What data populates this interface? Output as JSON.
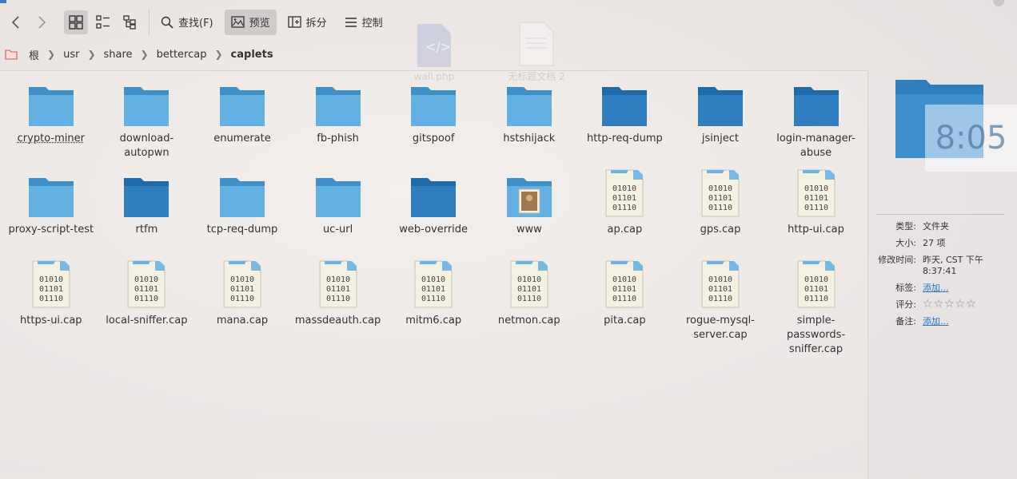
{
  "toolbar": {
    "find_label": "查找(F)",
    "preview_label": "预览",
    "split_label": "拆分",
    "control_label": "控制"
  },
  "breadcrumb": [
    "根",
    "usr",
    "share",
    "bettercap",
    "caplets"
  ],
  "desktop_ghosts": [
    "wall.php",
    "无标题文档 2"
  ],
  "items": [
    {
      "name": "crypto-miner",
      "type": "folder"
    },
    {
      "name": "download-autopwn",
      "type": "folder"
    },
    {
      "name": "enumerate",
      "type": "folder"
    },
    {
      "name": "fb-phish",
      "type": "folder"
    },
    {
      "name": "gitspoof",
      "type": "folder"
    },
    {
      "name": "hstshijack",
      "type": "folder"
    },
    {
      "name": "http-req-dump",
      "type": "folder"
    },
    {
      "name": "jsinject",
      "type": "folder"
    },
    {
      "name": "login-manager-abuse",
      "type": "folder"
    },
    {
      "name": "proxy-script-test",
      "type": "folder"
    },
    {
      "name": "rtfm",
      "type": "folder"
    },
    {
      "name": "tcp-req-dump",
      "type": "folder"
    },
    {
      "name": "uc-url",
      "type": "folder"
    },
    {
      "name": "web-override",
      "type": "folder"
    },
    {
      "name": "www",
      "type": "folder-image"
    },
    {
      "name": "ap.cap",
      "type": "cap"
    },
    {
      "name": "gps.cap",
      "type": "cap"
    },
    {
      "name": "http-ui.cap",
      "type": "cap"
    },
    {
      "name": "https-ui.cap",
      "type": "cap"
    },
    {
      "name": "local-sniffer.cap",
      "type": "cap"
    },
    {
      "name": "mana.cap",
      "type": "cap"
    },
    {
      "name": "massdeauth.cap",
      "type": "cap"
    },
    {
      "name": "mitm6.cap",
      "type": "cap"
    },
    {
      "name": "netmon.cap",
      "type": "cap"
    },
    {
      "name": "pita.cap",
      "type": "cap"
    },
    {
      "name": "rogue-mysql-server.cap",
      "type": "cap"
    },
    {
      "name": "simple-passwords-sniffer.cap",
      "type": "cap"
    }
  ],
  "binary_text": [
    "01010",
    "01101",
    "01110"
  ],
  "info": {
    "clock": "8:05",
    "type_key": "类型:",
    "type_val": "文件夹",
    "size_key": "大小:",
    "size_val": "27 项",
    "mtime_key": "修改时间:",
    "mtime_val": "昨天, CST 下午 8:37:41",
    "tags_key": "标签:",
    "tags_val": "添加...",
    "rating_key": "评分:",
    "rating_val": "☆☆☆☆☆",
    "notes_key": "备注:",
    "notes_val": "添加..."
  }
}
